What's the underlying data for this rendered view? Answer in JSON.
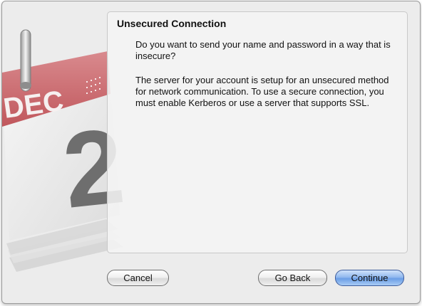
{
  "dialog": {
    "title": "Unsecured Connection",
    "question": "Do you want to send your name and password in a way that is insecure?",
    "explanation": "The server for your account is setup for an unsecured method for network communication. To use a secure connection, you must enable Kerberos or use a server that supports SSL."
  },
  "calendar_icon": {
    "month": "DEC",
    "day": "2",
    "icon": "ical-calendar-icon"
  },
  "buttons": {
    "cancel": "Cancel",
    "go_back": "Go Back",
    "continue": "Continue"
  },
  "colors": {
    "accent_default_button": "#7aa7e9",
    "calendar_red": "#c45a5e"
  }
}
